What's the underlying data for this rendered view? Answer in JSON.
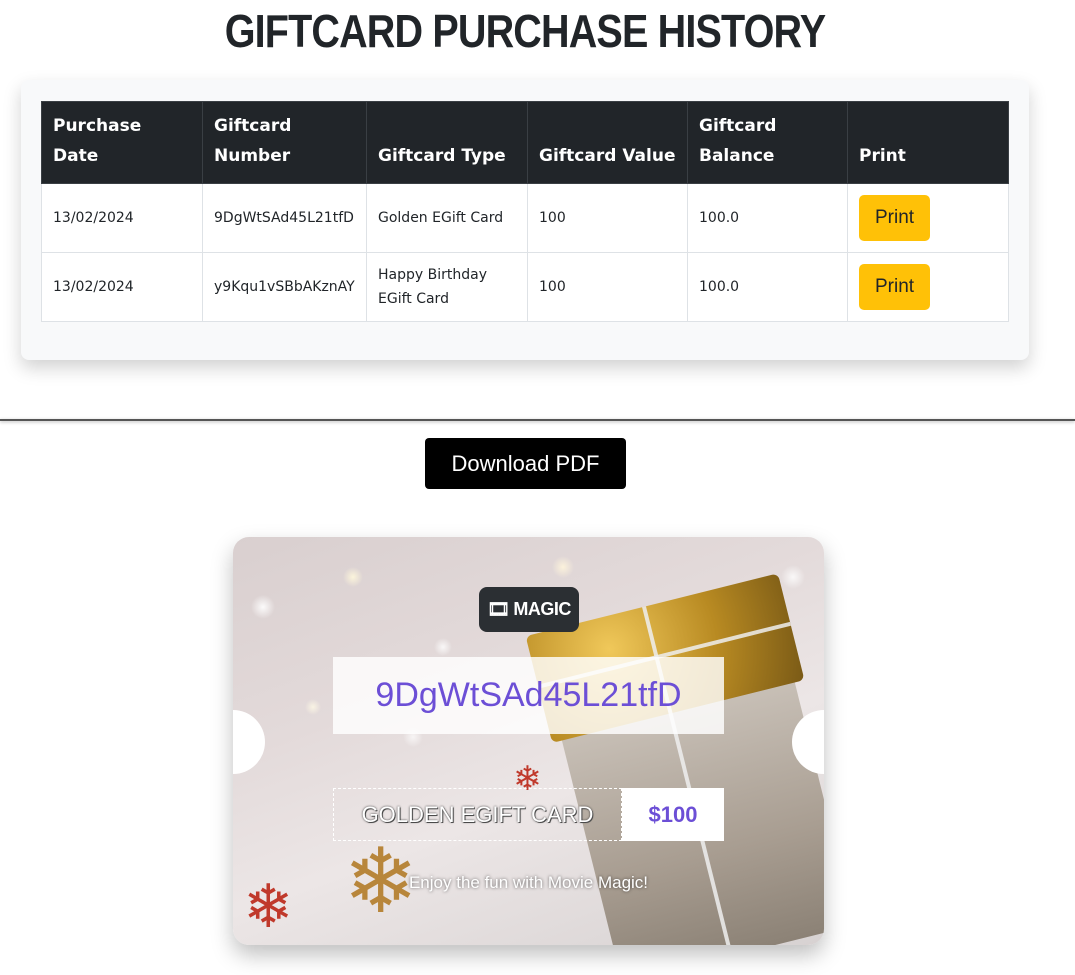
{
  "page": {
    "title": "GIFTCARD PURCHASE HISTORY"
  },
  "table": {
    "headers": [
      "Purchase Date",
      "Giftcard Number",
      "Giftcard Type",
      "Giftcard Value",
      "Giftcard Balance",
      "Print"
    ],
    "rows": [
      {
        "date": "13/02/2024",
        "number": "9DgWtSAd45L21tfD",
        "type": "Golden EGift Card",
        "value": "100",
        "balance": "100.0",
        "print_label": "Print"
      },
      {
        "date": "13/02/2024",
        "number": "y9Kqu1vSBbAKznAY",
        "type": "Happy Birthday EGift Card",
        "value": "100",
        "balance": "100.0",
        "print_label": "Print"
      }
    ]
  },
  "download": {
    "label": "Download PDF"
  },
  "gift_card": {
    "brand_icon": "film-icon",
    "brand_name": "MAGIC",
    "code": "9DgWtSAd45L21tfD",
    "type_label": "GOLDEN EGIFT CARD",
    "value_label": "$100",
    "tagline": "Enjoy the fun with Movie Magic!"
  },
  "colors": {
    "header_bg": "#212529",
    "print_button": "#ffc107",
    "code_text": "#6c4fd6",
    "download_button": "#000000"
  }
}
